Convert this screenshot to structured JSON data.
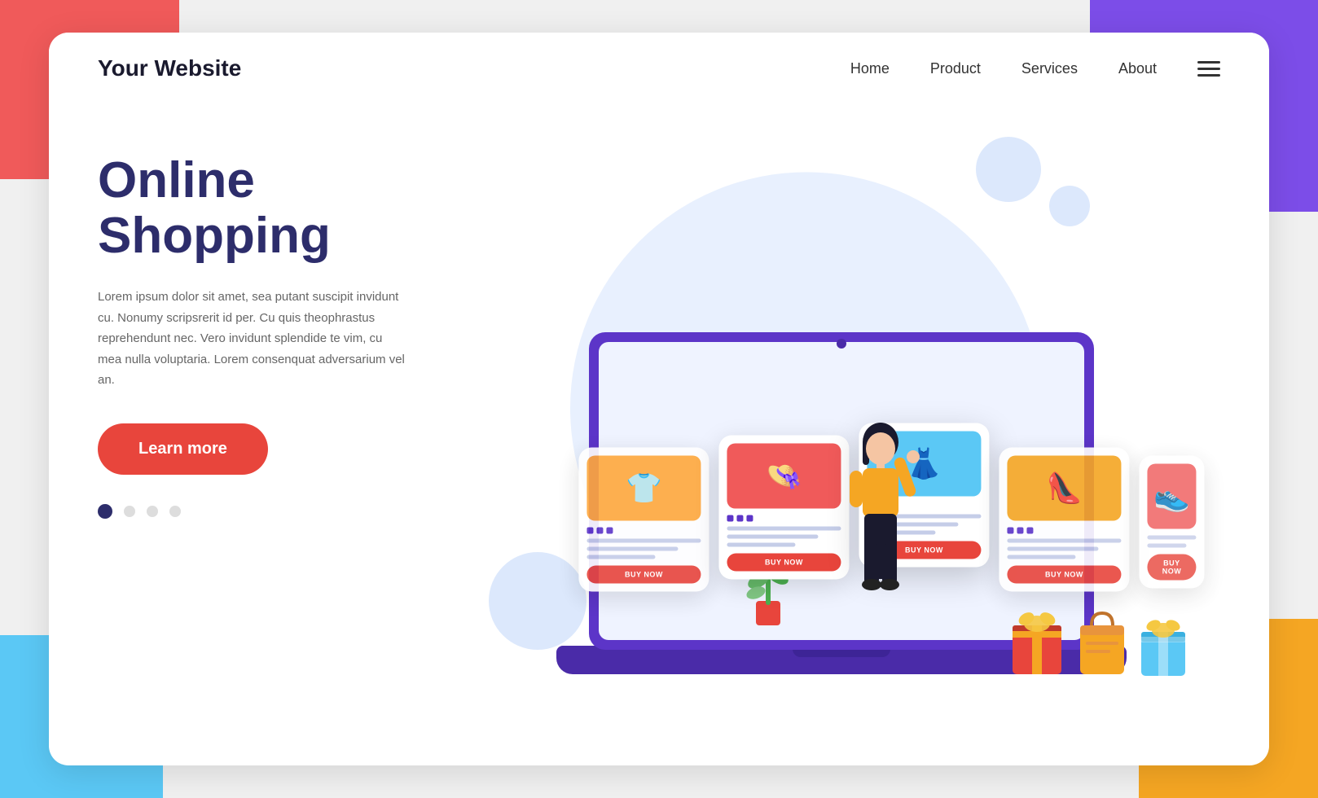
{
  "background": {
    "corners": {
      "tl_color": "#f05a5a",
      "tr_color": "#7c4de8",
      "bl_color": "#5bc8f5",
      "br_color": "#f5a623"
    }
  },
  "navbar": {
    "brand": "Your Website",
    "links": [
      {
        "label": "Home",
        "id": "home"
      },
      {
        "label": "Product",
        "id": "product"
      },
      {
        "label": "Services",
        "id": "services"
      },
      {
        "label": "About",
        "id": "about"
      }
    ],
    "menu_icon": "☰"
  },
  "hero": {
    "title_line1": "Online",
    "title_line2": "Shopping",
    "description": "Lorem ipsum dolor sit amet, sea putant suscipit invidunt cu. Nonumy scripsrerit id per. Cu quis theophrastus reprehendunt nec. Vero invidunt splendide te vim, cu mea nulla voluptaria. Lorem consenquat adversarium vel an.",
    "cta_label": "Learn more",
    "dots": [
      {
        "active": true
      },
      {
        "active": false
      },
      {
        "active": false
      },
      {
        "active": false
      }
    ]
  },
  "illustration": {
    "products": [
      {
        "id": "card1",
        "icon": "👕",
        "bg_class": "orange",
        "buy_label": "BUY NOW",
        "featured": false
      },
      {
        "id": "card2",
        "icon": "👗",
        "bg_class": "blue",
        "buy_label": "BUY NOW",
        "featured": true
      },
      {
        "id": "card3",
        "icon": "👠",
        "bg_class": "yellow-red",
        "buy_label": "BUY NOW",
        "featured": false
      },
      {
        "id": "card4",
        "icon": "👟",
        "bg_class": "red",
        "buy_label": "BUY NOW",
        "featured": false
      }
    ]
  }
}
